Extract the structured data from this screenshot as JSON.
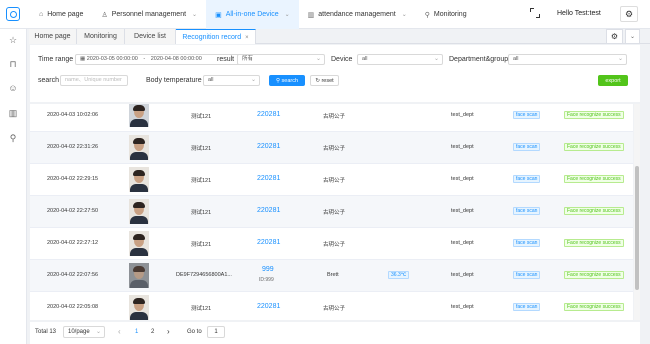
{
  "topnav": {
    "items": [
      {
        "label": "Home page",
        "icon": "home-icon"
      },
      {
        "label": "Personnel management",
        "icon": "user-icon"
      },
      {
        "label": "All-in-one Device",
        "icon": "device-icon"
      },
      {
        "label": "attendance management",
        "icon": "chart-icon"
      },
      {
        "label": "Monitoring",
        "icon": "monitor-icon"
      }
    ],
    "user": "Hello Test:test",
    "accent": "#1890ff"
  },
  "tabs": [
    {
      "label": "Home page"
    },
    {
      "label": "Monitoring"
    },
    {
      "label": "Device list"
    },
    {
      "label": "Recognition record",
      "close": "×"
    }
  ],
  "filters": {
    "time_range_label": "Time range",
    "time_start": "2020-03-05 00:00:00",
    "time_sep": "-",
    "time_end": "2020-04-08 00:00:00",
    "result_label": "result",
    "result_value": "所有",
    "device_label": "Device",
    "device_value": "all",
    "dept_label": "Department&group",
    "dept_value": "all",
    "search_label": "search",
    "name_placeholder": "name、Unique number",
    "temp_label": "Body temperature",
    "temp_value": "all",
    "search_btn": "search",
    "reset_btn": "reset",
    "export_btn": "export"
  },
  "rows": [
    {
      "time": "2020-04-03 10:02:06",
      "name": "测试121",
      "id": "220281",
      "id2": "",
      "group": "古玥公子",
      "temp": "",
      "dept": "test_dept",
      "type": "face scan",
      "result": "Face recognize success"
    },
    {
      "time": "2020-04-02 22:31:26",
      "name": "测试121",
      "id": "220281",
      "id2": "",
      "group": "古玥公子",
      "temp": "",
      "dept": "test_dept",
      "type": "face scan",
      "result": "Face recognize success"
    },
    {
      "time": "2020-04-02 22:29:15",
      "name": "测试121",
      "id": "220281",
      "id2": "",
      "group": "古玥公子",
      "temp": "",
      "dept": "test_dept",
      "type": "face scan",
      "result": "Face recognize success"
    },
    {
      "time": "2020-04-02 22:27:50",
      "name": "测试121",
      "id": "220281",
      "id2": "",
      "group": "古玥公子",
      "temp": "",
      "dept": "test_dept",
      "type": "face scan",
      "result": "Face recognize success"
    },
    {
      "time": "2020-04-02 22:27:12",
      "name": "测试121",
      "id": "220281",
      "id2": "",
      "group": "古玥公子",
      "temp": "",
      "dept": "test_dept",
      "type": "face scan",
      "result": "Face recognize success"
    },
    {
      "time": "2020-04-02 22:07:56",
      "name": "DE9F7294656800A1...",
      "id": "999",
      "id2": "ID:999",
      "group": "Brett",
      "temp": "36.3℃",
      "dept": "test_dept",
      "type": "face scan",
      "result": "Face recognize success"
    },
    {
      "time": "2020-04-02 22:05:08",
      "name": "测试121",
      "id": "220281",
      "id2": "",
      "group": "古玥公子",
      "temp": "",
      "dept": "test_dept",
      "type": "face scan",
      "result": "Face recognize success"
    }
  ],
  "pagination": {
    "total": "Total 13",
    "page_size": "10/page",
    "prev": "‹",
    "pages": [
      "1",
      "2"
    ],
    "next": "›",
    "goto_label": "Go to",
    "goto_value": "1"
  }
}
